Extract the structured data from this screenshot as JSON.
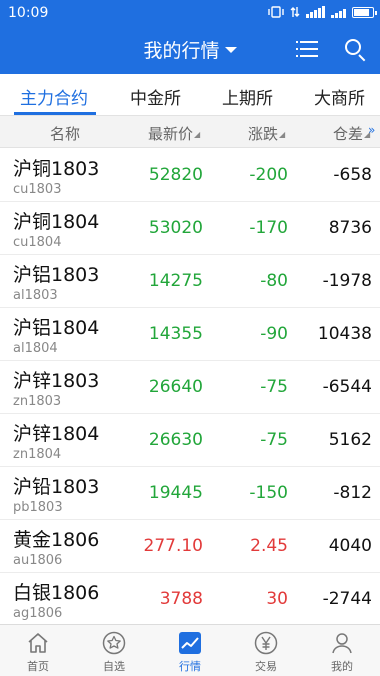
{
  "status_bar": {
    "time": "10:09"
  },
  "header": {
    "title": "我的行情"
  },
  "tabs": [
    "主力合约",
    "中金所",
    "上期所",
    "大商所"
  ],
  "columns": {
    "name": "名称",
    "price": "最新价",
    "change": "涨跌",
    "position": "仓差"
  },
  "rows": [
    {
      "name": "沪铜1803",
      "code": "cu1803",
      "price": "52820",
      "change": "-200",
      "position": "-658",
      "direction": "down"
    },
    {
      "name": "沪铜1804",
      "code": "cu1804",
      "price": "53020",
      "change": "-170",
      "position": "8736",
      "direction": "down"
    },
    {
      "name": "沪铝1803",
      "code": "al1803",
      "price": "14275",
      "change": "-80",
      "position": "-1978",
      "direction": "down"
    },
    {
      "name": "沪铝1804",
      "code": "al1804",
      "price": "14355",
      "change": "-90",
      "position": "10438",
      "direction": "down"
    },
    {
      "name": "沪锌1803",
      "code": "zn1803",
      "price": "26640",
      "change": "-75",
      "position": "-6544",
      "direction": "down"
    },
    {
      "name": "沪锌1804",
      "code": "zn1804",
      "price": "26630",
      "change": "-75",
      "position": "5162",
      "direction": "down"
    },
    {
      "name": "沪铅1803",
      "code": "pb1803",
      "price": "19445",
      "change": "-150",
      "position": "-812",
      "direction": "down"
    },
    {
      "name": "黄金1806",
      "code": "au1806",
      "price": "277.10",
      "change": "2.45",
      "position": "4040",
      "direction": "up"
    },
    {
      "name": "白银1806",
      "code": "ag1806",
      "price": "3788",
      "change": "30",
      "position": "-2744",
      "direction": "up"
    }
  ],
  "bottom_nav": [
    {
      "label": "首页",
      "icon": "home-icon"
    },
    {
      "label": "自选",
      "icon": "star-icon"
    },
    {
      "label": "行情",
      "icon": "chart-icon",
      "active": true
    },
    {
      "label": "交易",
      "icon": "yen-icon"
    },
    {
      "label": "我的",
      "icon": "person-icon"
    }
  ],
  "colors": {
    "brand": "#1f6fe0",
    "up": "#e23a3a",
    "down": "#22a63a"
  }
}
